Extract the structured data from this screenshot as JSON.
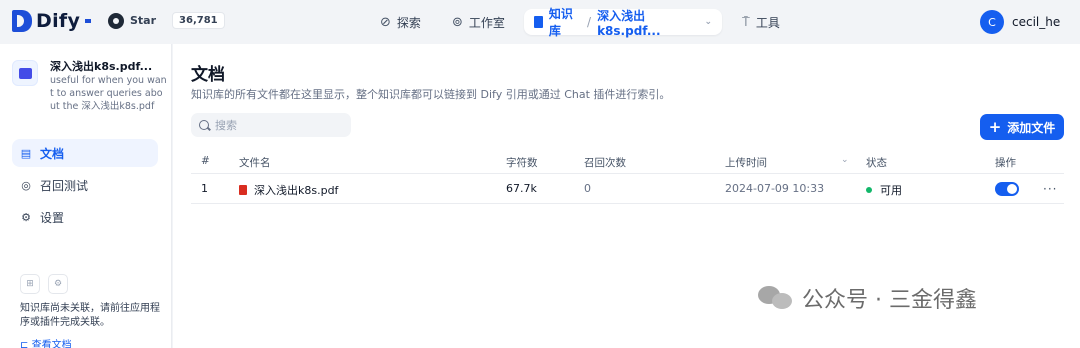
{
  "header": {
    "logo_text": "Dify",
    "github_star": "Star",
    "github_count": "36,781",
    "nav": {
      "explore": "探索",
      "studio": "工作室",
      "knowledge": "知识库",
      "knowledge_current": "深入浅出k8s.pdf...",
      "tools": "工具"
    },
    "user": {
      "avatar_letter": "C",
      "name": "cecil_he"
    }
  },
  "sidebar": {
    "dataset_name": "深入浅出k8s.pdf...",
    "dataset_desc": "useful for when you want to answer queries about the 深入浅出k8s.pdf",
    "items": [
      {
        "label": "文档",
        "icon": "document-icon",
        "active": true
      },
      {
        "label": "召回测试",
        "icon": "target-icon",
        "active": false
      },
      {
        "label": "设置",
        "icon": "gear-icon",
        "active": false
      }
    ],
    "tip_text": "知识库尚未关联，请前往应用程序或插件完成关联。",
    "tip_link": "查看文档"
  },
  "main": {
    "title": "文档",
    "description": "知识库的所有文件都在这里显示，整个知识库都可以链接到 Dify 引用或通过 Chat 插件进行索引。",
    "search_placeholder": "搜索",
    "add_button": "添加文件",
    "columns": [
      "#",
      "文件名",
      "字符数",
      "召回次数",
      "上传时间",
      "状态",
      "操作"
    ],
    "rows": [
      {
        "num": "1",
        "name": "深入浅出k8s.pdf",
        "chars": "67.7k",
        "recall": "0",
        "time": "2024-07-09 10:33",
        "status": "可用",
        "enabled": true
      }
    ]
  },
  "watermark": "公众号 · 三金得鑫",
  "colors": {
    "accent": "#155eef",
    "status_ok": "#12b76a",
    "pdf": "#d92d20"
  }
}
